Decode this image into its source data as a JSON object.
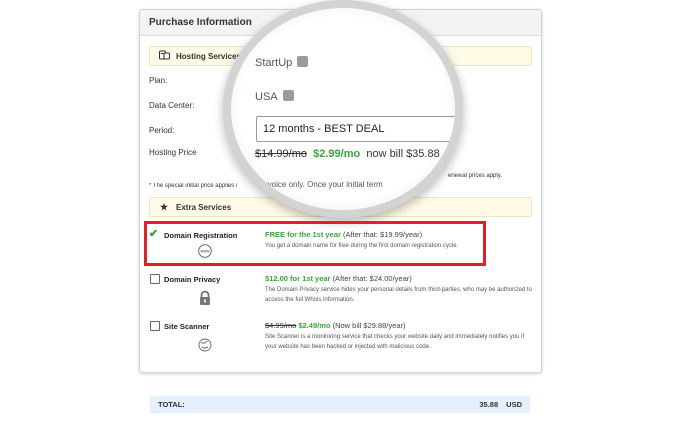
{
  "panel": {
    "title": "Purchase Information"
  },
  "hosting": {
    "section_label": "Hosting Services",
    "plan_label": "Plan:",
    "plan_value": "StartUp",
    "datacenter_label": "Data Center:",
    "datacenter_value": "USA",
    "period_label": "Period:",
    "period_value": "12 months - BEST DEAL",
    "price_label": "Hosting Price",
    "price_old": "$14.99/mo",
    "price_new": "$2.99/mo",
    "price_bill": "now bill $35.88",
    "note_left": "* The special initial price applies i",
    "note_mid": "t invoice only. Once your initial term",
    "note_right": "enewal prices apply."
  },
  "extras": {
    "section_label": "Extra Services",
    "items": [
      {
        "name": "Domain Registration",
        "checked": true,
        "icon": "www-globe-icon",
        "icon_text": "www",
        "price_highlight": "FREE for the 1st year",
        "price_after": "(After that: $19.99/year)",
        "description": "You get a domain name for free during the first domain registration cycle."
      },
      {
        "name": "Domain Privacy",
        "checked": false,
        "icon": "padlock-icon",
        "price_highlight": "$12.00 for 1st year",
        "price_after": "(After that: $24.00/year)",
        "description": "The Domain Privacy service hides your personal details from third-parties, who may be authorized to access the full Whois information."
      },
      {
        "name": "Site Scanner",
        "checked": false,
        "icon": "scanner-globe-icon",
        "price_old": "$4.99/mo",
        "price_highlight": "$2.49/mo",
        "price_after": "(Now bill $29.88/year)",
        "description": "Site Scanner is a monitoring service that checks your website daily and immediately notifies you if your website has been hacked or injected with malicious code."
      }
    ]
  },
  "total": {
    "label": "TOTAL:",
    "amount": "35.88",
    "currency": "USD"
  },
  "colors": {
    "accent_green": "#3aa53a",
    "highlight_red": "#e0202a",
    "section_bg": "#fffbe6",
    "total_bg": "#e4f0fb"
  }
}
